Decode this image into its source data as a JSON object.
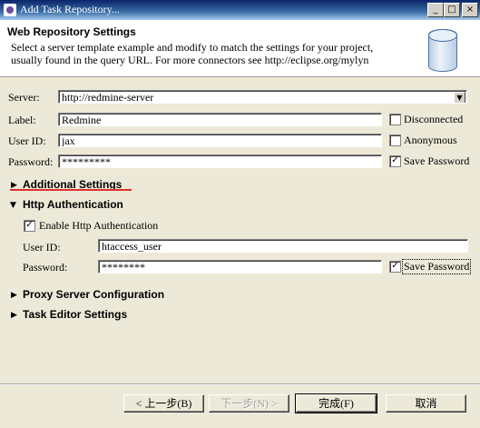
{
  "window": {
    "title": "Add Task Repository..."
  },
  "header": {
    "title": "Web Repository Settings",
    "description_line1": "Select a server template example and modify to match the settings for your project,",
    "description_line2": "usually found in the query URL.  For more connectors see http://eclipse.org/mylyn"
  },
  "form": {
    "server_label": "Server:",
    "server_value": "http://redmine-server",
    "label_label": "Label:",
    "label_value": "Redmine",
    "userid_label": "User ID:",
    "userid_value": "jax",
    "password_label": "Password:",
    "password_value": "*********",
    "disconnected_label": "Disconnected",
    "disconnected_checked": false,
    "anonymous_label": "Anonymous",
    "anonymous_checked": false,
    "save_password_label": "Save Password",
    "save_password_checked": true
  },
  "sections": {
    "additional": "Additional Settings",
    "http_auth": "Http Authentication",
    "proxy": "Proxy Server Configuration",
    "task_editor": "Task Editor Settings"
  },
  "http_auth": {
    "enable_label": "Enable Http Authentication",
    "enable_checked": true,
    "userid_label": "User ID:",
    "userid_value": "htaccess_user",
    "password_label": "Password:",
    "password_value": "********",
    "save_password_label": "Save Password",
    "save_password_checked": true
  },
  "buttons": {
    "back": "< 上一步(B)",
    "next": "下一步(N) >",
    "finish": "完成(F)",
    "cancel": "取消"
  },
  "colors": {
    "titlebar": "#0a246a",
    "dialog_bg": "#ece9d8",
    "annotation_underline": "#e0302a"
  }
}
